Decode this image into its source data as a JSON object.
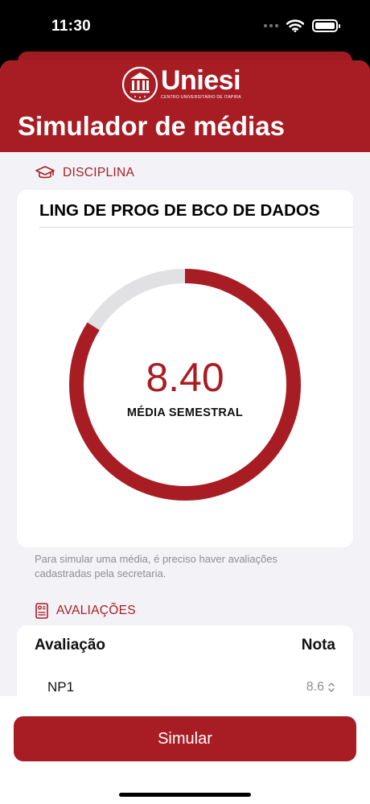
{
  "status_bar": {
    "time": "11:30",
    "signal_icon": "signal-dots-icon",
    "wifi_icon": "wifi-icon",
    "battery_icon": "battery-icon"
  },
  "header": {
    "logo_text": "Uniesi",
    "logo_subtitle": "CENTRO UNIVERSITÁRIO DE ITAPIRA",
    "title": "Simulador de médias",
    "color": "#a81d24"
  },
  "disciplina": {
    "section_label": "DISCIPLINA",
    "icon": "graduation-cap-icon",
    "name": "LING DE PROG DE BCO DE DADOS",
    "average": "8.40",
    "average_label": "MÉDIA SEMESTRAL",
    "progress_fraction": 0.84,
    "progress_color": "#a81d24",
    "track_color": "#e1e1e3",
    "footnote": "Para simular uma média, é preciso haver avaliações cadastradas pela secretaria."
  },
  "avaliacoes": {
    "section_label": "AVALIAÇÕES",
    "icon": "report-card-icon",
    "col_evaluation": "Avaliação",
    "col_grade": "Nota",
    "rows": [
      {
        "name": "NP1",
        "grade": "8.6"
      }
    ]
  },
  "actions": {
    "simulate_label": "Simular"
  }
}
